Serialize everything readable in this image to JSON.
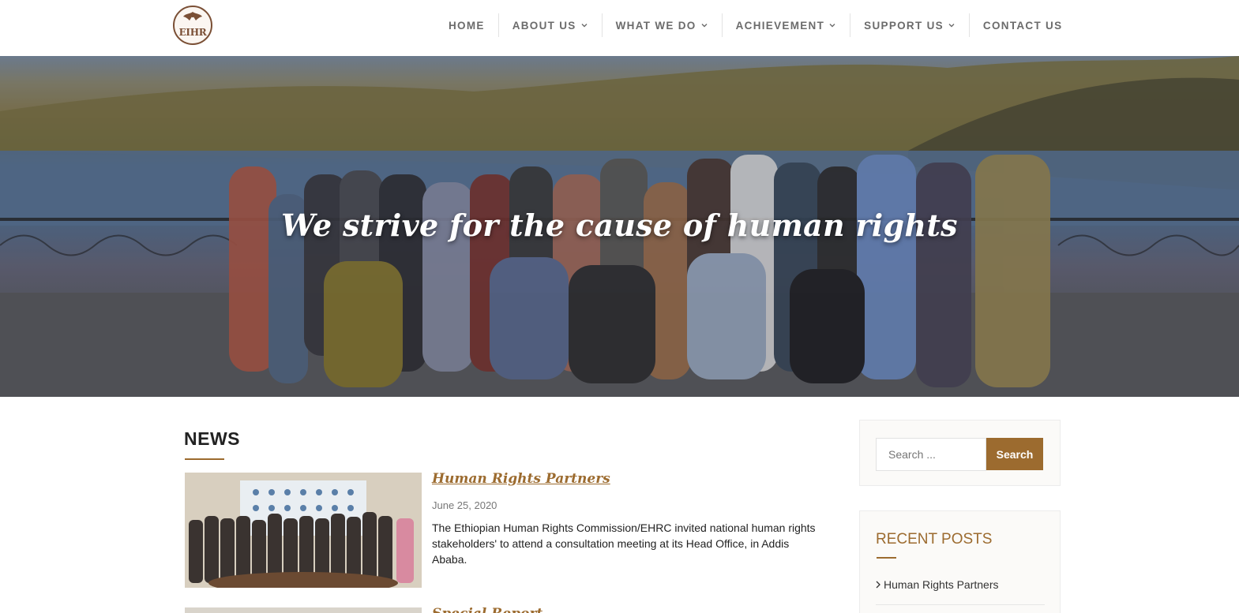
{
  "header": {
    "logo_text": "EIHR",
    "nav": [
      {
        "label": "HOME",
        "has_dropdown": false
      },
      {
        "label": "ABOUT US",
        "has_dropdown": true
      },
      {
        "label": "WHAT WE DO",
        "has_dropdown": true
      },
      {
        "label": "ACHIEVEMENT",
        "has_dropdown": true
      },
      {
        "label": "SUPPORT US",
        "has_dropdown": true
      },
      {
        "label": "CONTACT US",
        "has_dropdown": false
      }
    ]
  },
  "hero": {
    "tagline": "We strive for the cause of human rights"
  },
  "news": {
    "heading": "NEWS",
    "posts": [
      {
        "title": "Human Rights Partners",
        "date": "June 25, 2020",
        "excerpt": "The Ethiopian Human Rights Commission/EHRC invited national human rights stakeholders' to attend a consultation meeting at its Head Office, in Addis Ababa."
      },
      {
        "title": "Special Report",
        "date": "",
        "excerpt": ""
      }
    ]
  },
  "sidebar": {
    "search": {
      "placeholder": "Search ...",
      "button_label": "Search"
    },
    "recent_posts": {
      "title": "RECENT POSTS",
      "items": [
        "Human Rights Partners"
      ]
    }
  },
  "colors": {
    "accent": "#9c6b2f",
    "nav_text": "#6b6b6b",
    "logo": "#7a4f35"
  }
}
